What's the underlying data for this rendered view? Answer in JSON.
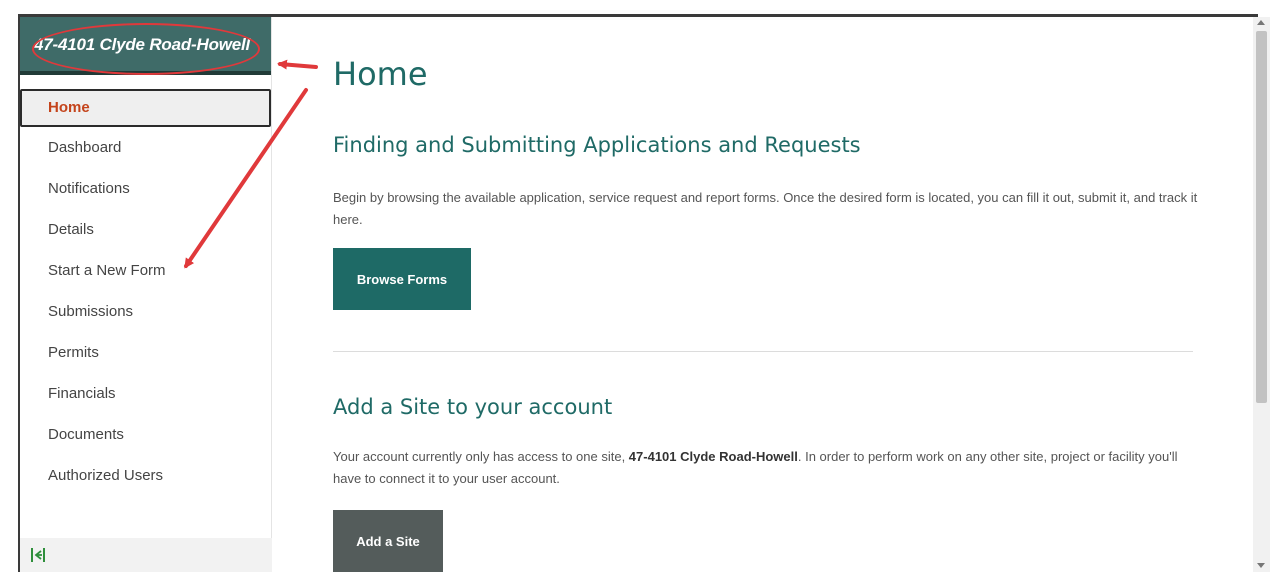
{
  "sidebar": {
    "site_name": "47-4101 Clyde Road-Howell",
    "items": [
      {
        "label": "Home",
        "active": true
      },
      {
        "label": "Dashboard"
      },
      {
        "label": "Notifications"
      },
      {
        "label": "Details"
      },
      {
        "label": "Start a New Form"
      },
      {
        "label": "Submissions"
      },
      {
        "label": "Permits"
      },
      {
        "label": "Financials"
      },
      {
        "label": "Documents"
      },
      {
        "label": "Authorized Users"
      }
    ],
    "collapse_icon": "collapse-sidebar-icon"
  },
  "main": {
    "title": "Home",
    "sections": [
      {
        "heading": "Finding and Submitting Applications and Requests",
        "text": "Begin by browsing the available application, service request and report forms. Once the desired form is located, you can fill it out, submit it, and track it here.",
        "button": "Browse Forms"
      },
      {
        "heading": "Add a Site to your account",
        "text_before": "Your account currently only has access to one site, ",
        "text_site": "47-4101 Clyde Road-Howell",
        "text_after": ". In order to perform work on any other site, project or facility you'll have to connect it to your user account.",
        "button": "Add a Site"
      }
    ]
  },
  "colors": {
    "brand_teal": "#1e6a66",
    "header_bg": "#3f6b68",
    "active_nav_text": "#c4441c",
    "annotation_red": "#e0393b"
  }
}
